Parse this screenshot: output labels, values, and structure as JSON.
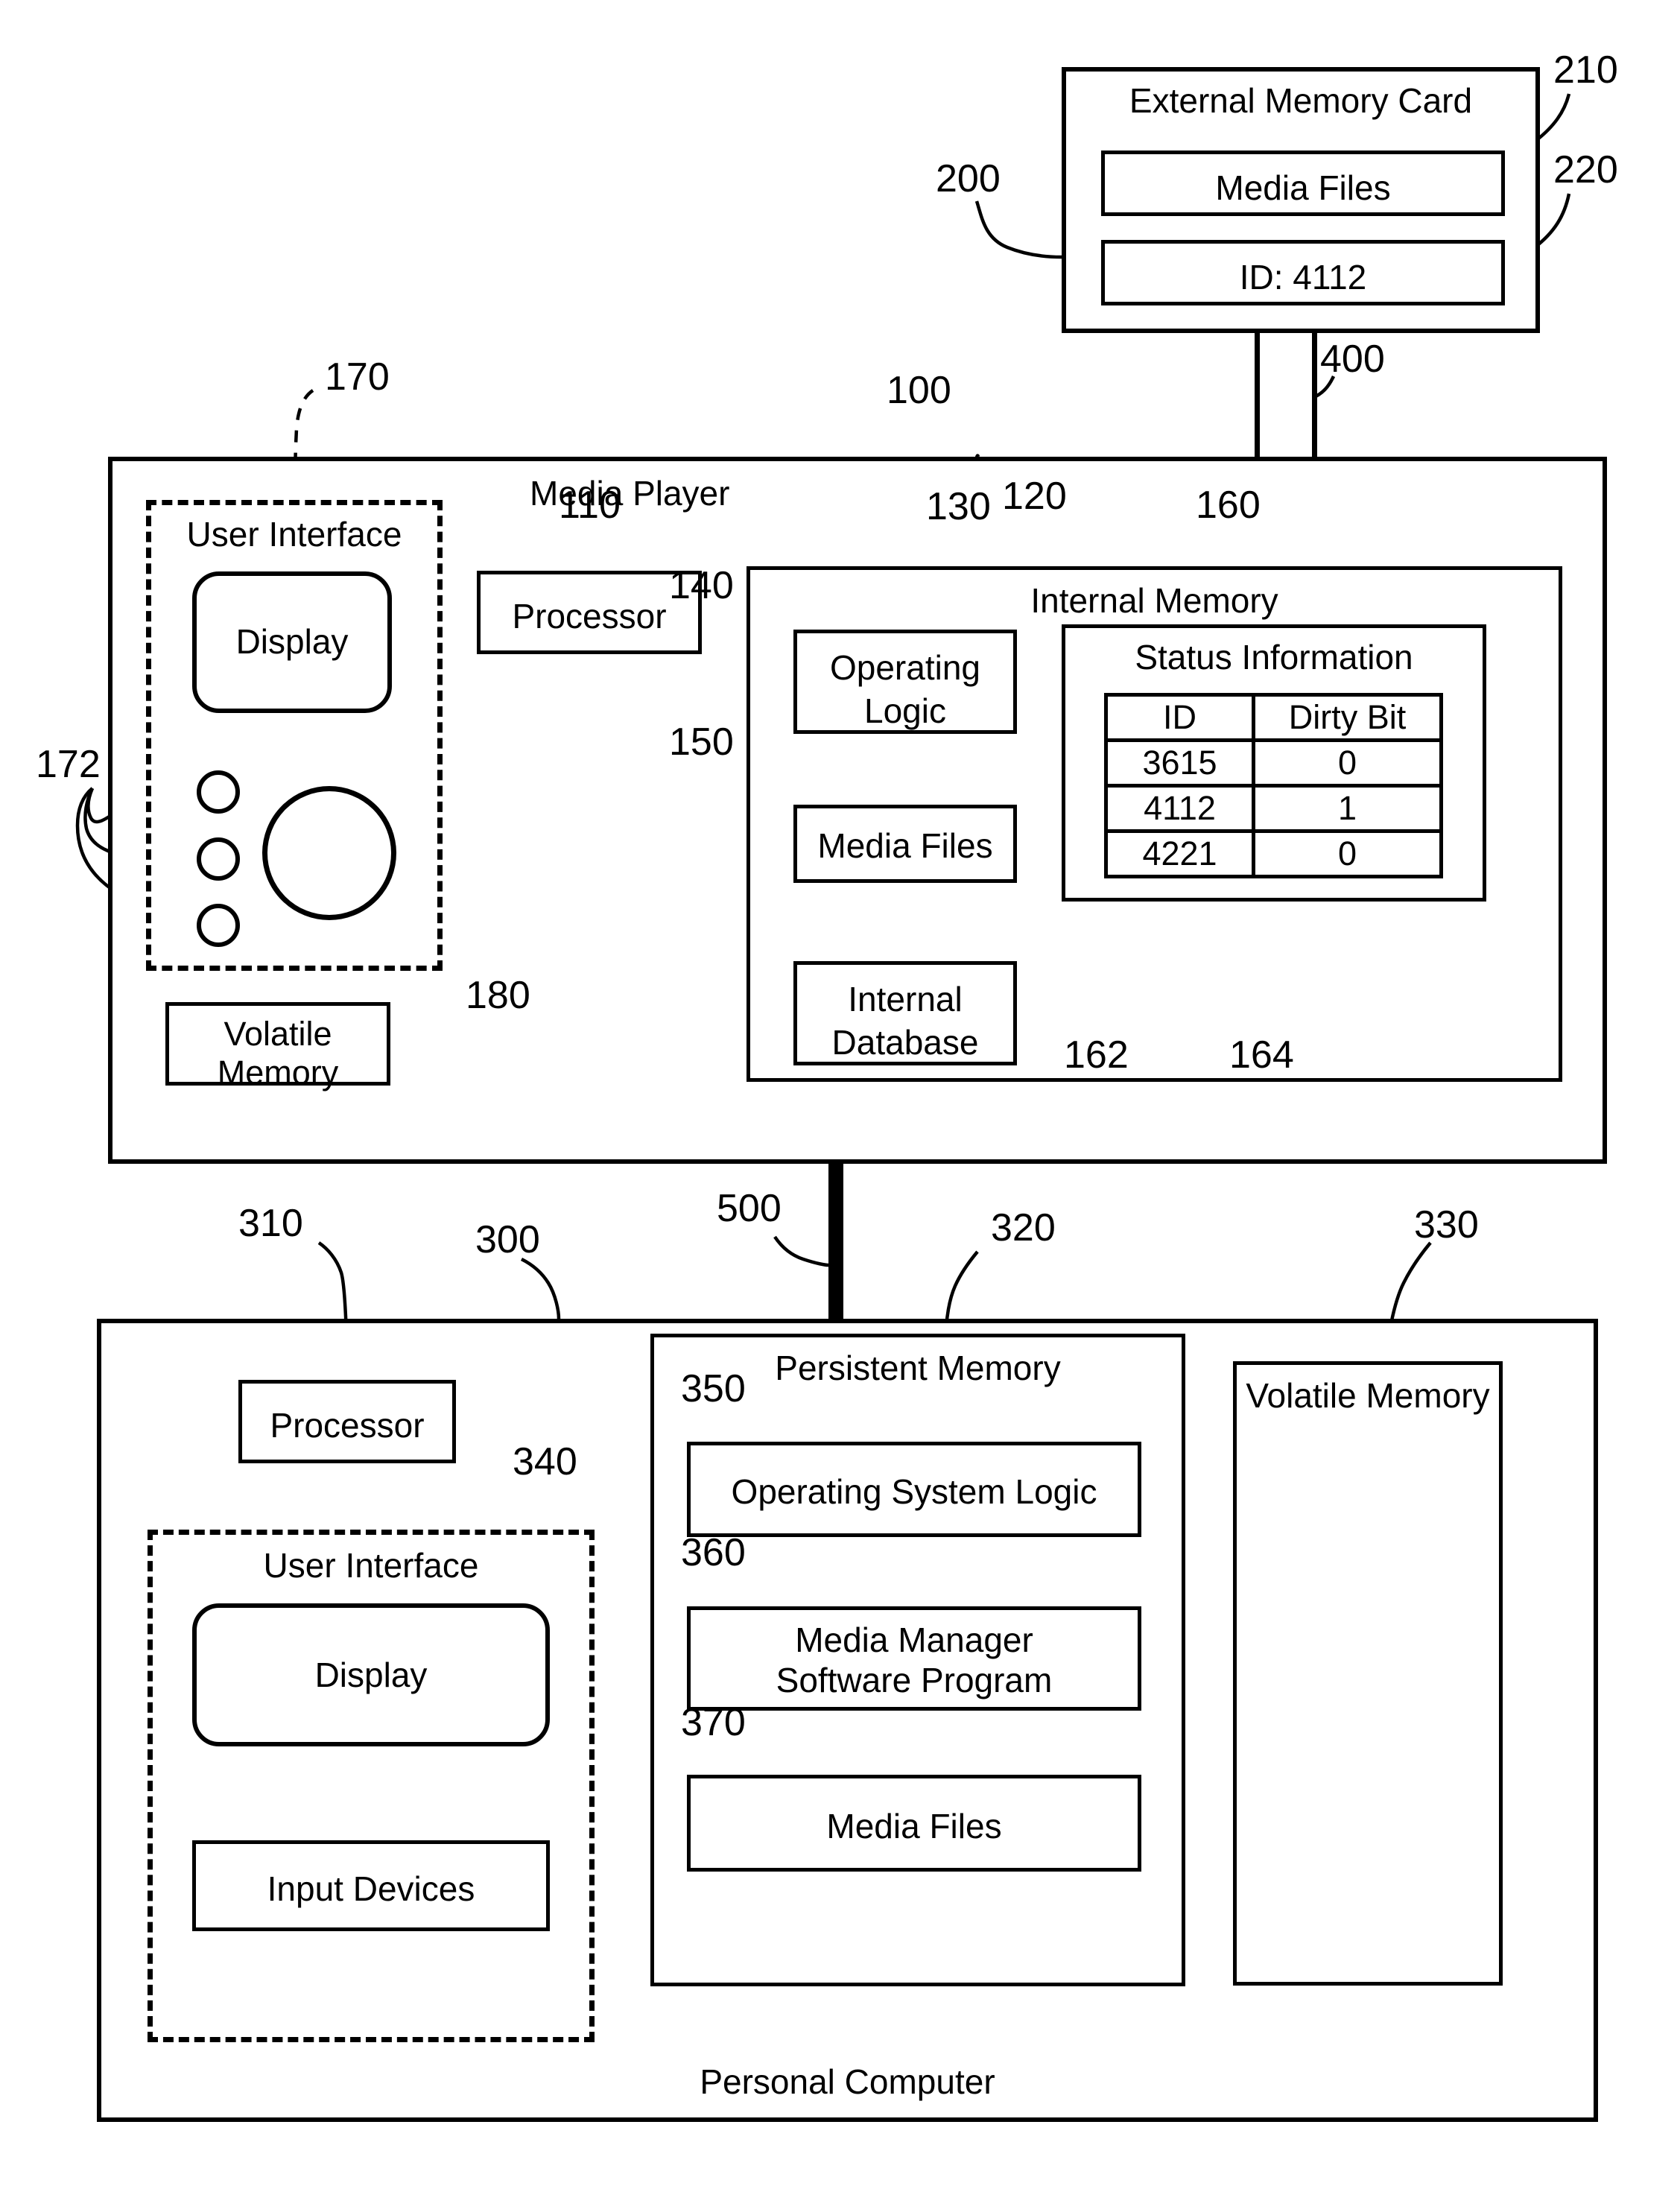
{
  "figure": {
    "external_memory_card": {
      "title": "External Memory Card",
      "ref": "200",
      "media_files": {
        "label": "Media Files",
        "ref": "210"
      },
      "id_box": {
        "label": "ID: 4112",
        "ref": "220"
      }
    },
    "connector_card_to_player": {
      "ref": "400"
    },
    "media_player": {
      "title": "Media Player",
      "ref": "100",
      "user_interface": {
        "title": "User Interface",
        "ref": "170",
        "display": "Display",
        "buttons_ref": "172"
      },
      "processor": {
        "label": "Processor",
        "ref": "110"
      },
      "volatile_memory": {
        "label": "Volatile Memory",
        "ref": "180"
      },
      "internal_memory": {
        "title": "Internal Memory",
        "ref": "120",
        "operating_logic": {
          "label": "Operating Logic",
          "ref": "130"
        },
        "media_files": {
          "label": "Media Files",
          "ref": "140"
        },
        "internal_database": {
          "label": "Internal Database",
          "ref": "150"
        },
        "status_information": {
          "title": "Status Information",
          "ref": "160",
          "id_column_ref": "162",
          "dirty_bit_column_ref": "164",
          "columns": [
            "ID",
            "Dirty Bit"
          ],
          "rows": [
            [
              "3615",
              "0"
            ],
            [
              "4112",
              "1"
            ],
            [
              "4221",
              "0"
            ]
          ]
        }
      }
    },
    "connector_player_to_pc": {
      "ref": "500"
    },
    "personal_computer": {
      "title": "Personal Computer",
      "ref": "300",
      "processor": {
        "label": "Processor",
        "ref": "310"
      },
      "user_interface": {
        "title": "User Interface",
        "ref": "340",
        "display": "Display",
        "input_devices": "Input Devices"
      },
      "persistent_memory": {
        "title": "Persistent Memory",
        "ref": "320",
        "operating_system_logic": {
          "label": "Operating System Logic",
          "ref": "350"
        },
        "media_manager": {
          "line1": "Media Manager",
          "line2": "Software Program",
          "ref": "360"
        },
        "media_files": {
          "label": "Media Files",
          "ref": "370"
        }
      },
      "volatile_memory": {
        "title": "Volatile Memory",
        "ref": "330"
      }
    }
  }
}
